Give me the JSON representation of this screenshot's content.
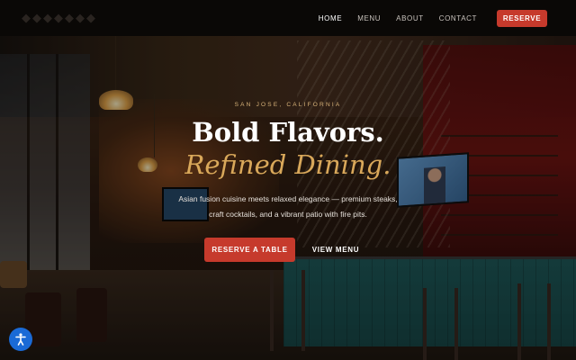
{
  "nav": {
    "links": [
      {
        "label": "HOME",
        "active": true
      },
      {
        "label": "MENU",
        "active": false
      },
      {
        "label": "ABOUT",
        "active": false
      },
      {
        "label": "CONTACT",
        "active": false
      }
    ],
    "reserve_label": "RESERVE"
  },
  "hero": {
    "eyebrow": "SAN JOSE, CALIFORNIA",
    "headline": "Bold Flavors.",
    "headline_accent": "Refined Dining.",
    "subtext": "Asian fusion cuisine meets relaxed elegance — premium steaks, craft cocktails, and a vibrant patio with fire pits.",
    "primary_cta": "RESERVE A TABLE",
    "secondary_cta": "VIEW MENU"
  },
  "accessibility": {
    "icon": "accessibility-icon"
  },
  "colors": {
    "accent_red": "#c63a2c",
    "accent_gold": "#d9a85a",
    "eyebrow_gold": "#d9b47a",
    "nav_bg": "#0a0806",
    "a11y_blue": "#1a6ad6"
  }
}
